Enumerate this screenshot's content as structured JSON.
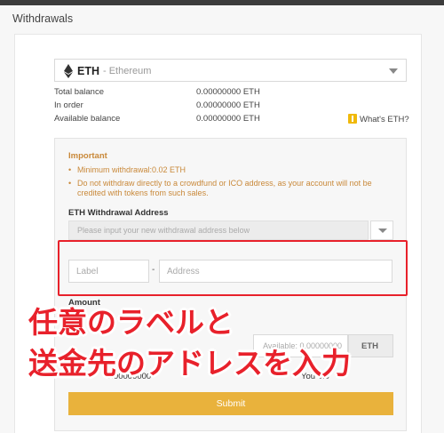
{
  "page": {
    "title": "Withdrawals"
  },
  "coin": {
    "symbol": "ETH",
    "name": "- Ethereum",
    "icon": "ethereum-icon"
  },
  "balances": [
    {
      "label": "Total balance",
      "value": "0.00000000 ETH"
    },
    {
      "label": "In order",
      "value": "0.00000000 ETH"
    },
    {
      "label": "Available balance",
      "value": "0.00000000 ETH"
    }
  ],
  "whats_eth": "What's ETH?",
  "important": {
    "title": "Important",
    "notices": [
      "Minimum withdrawal:0.02 ETH",
      "Do not withdraw directly to a crowdfund or ICO address, as your account will not be credited with tokens from such sales."
    ]
  },
  "address": {
    "heading": "ETH Withdrawal Address",
    "select_placeholder": "Please input your new withdrawal address below",
    "label_placeholder": "Label",
    "separator": "-",
    "address_placeholder": "Address"
  },
  "amount": {
    "heading": "Amount",
    "available_text": "Available: 0.00000000",
    "unit": "ETH",
    "fee_left": "0.00000000",
    "fee_right": "You 0.0"
  },
  "submit_label": "Submit",
  "annotation": {
    "line1": "任意のラベルと",
    "line2": "送金先のアドレスを入力"
  },
  "colors": {
    "accent": "#e9b23c",
    "warning": "#c9893a",
    "highlight": "#e8212b"
  }
}
